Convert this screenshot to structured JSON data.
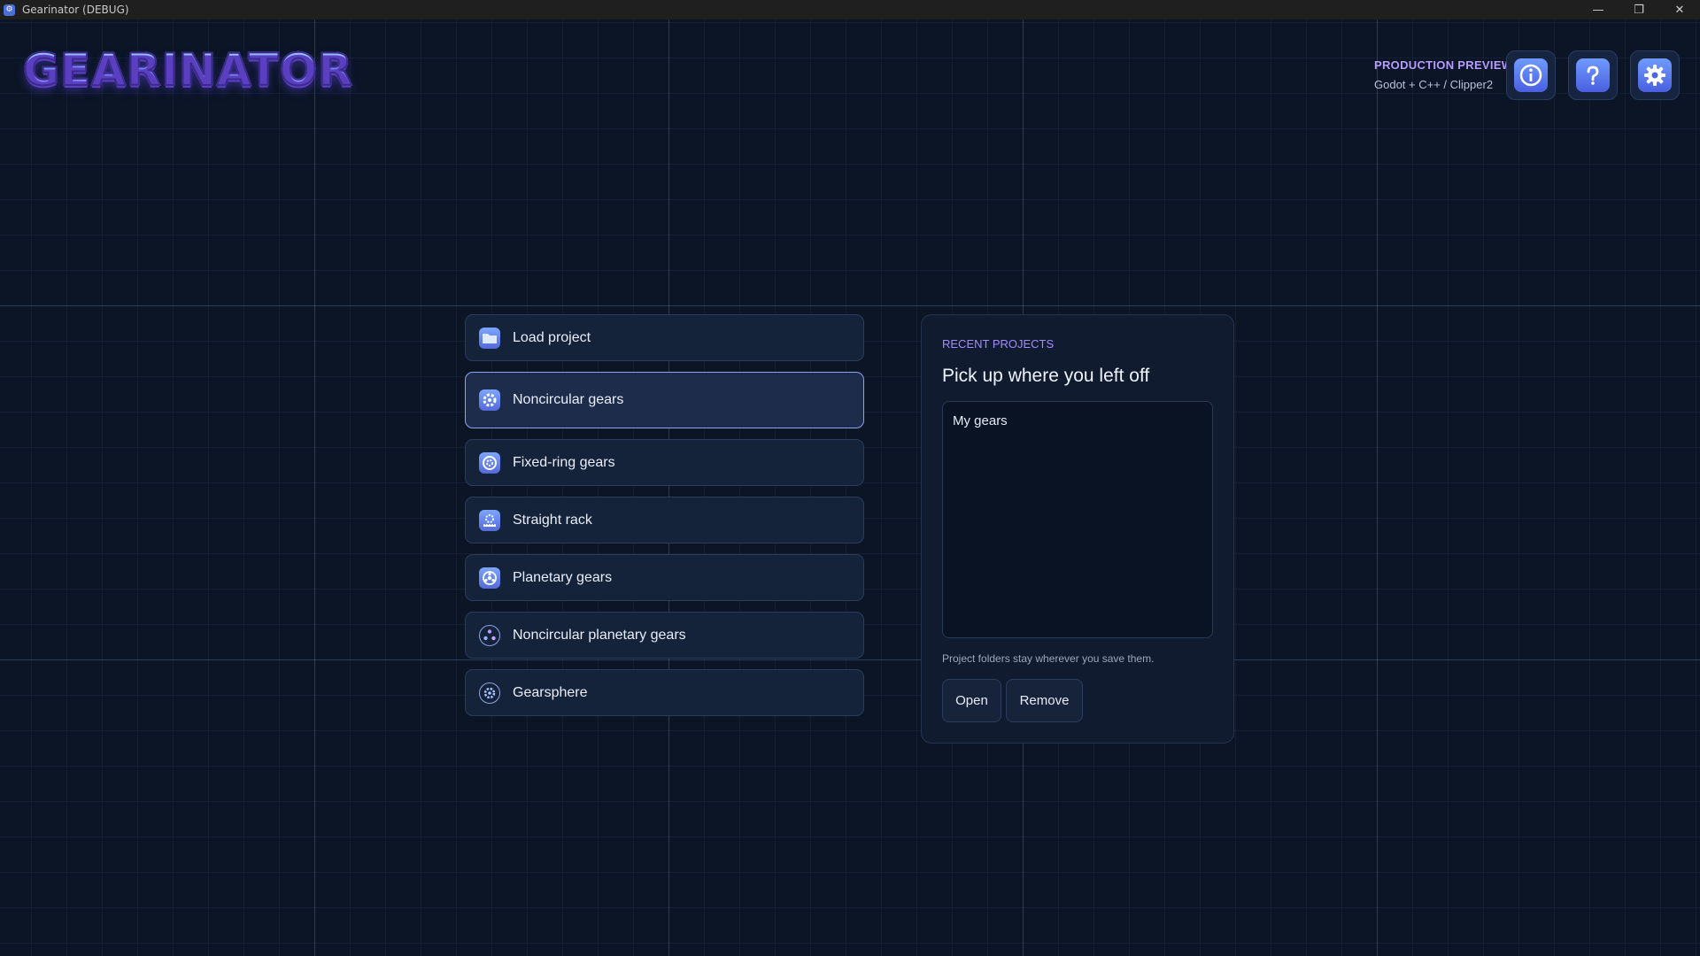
{
  "window": {
    "title": "Gearinator (DEBUG)",
    "controls": [
      "minimize",
      "restore",
      "close"
    ]
  },
  "logo": {
    "text": "GEARINATOR"
  },
  "header": {
    "preview_title": "PRODUCTION PREVIEW",
    "preview_subtitle": "Godot + C++ / Clipper2",
    "buttons": [
      {
        "name": "info",
        "icon": "info-icon"
      },
      {
        "name": "help",
        "icon": "help-icon"
      },
      {
        "name": "settings",
        "icon": "gear-icon"
      }
    ]
  },
  "menu": {
    "items": [
      {
        "label": "Load project",
        "icon": "folder-icon",
        "selected": false
      },
      {
        "label": "Noncircular gears",
        "icon": "gear-icon",
        "selected": true
      },
      {
        "label": "Fixed-ring gears",
        "icon": "ring-gear-icon",
        "selected": false
      },
      {
        "label": "Straight rack",
        "icon": "rack-icon",
        "selected": false
      },
      {
        "label": "Planetary gears",
        "icon": "planetary-icon",
        "selected": false
      },
      {
        "label": "Noncircular planetary gears",
        "icon": "noncircular-planetary-icon",
        "selected": false
      },
      {
        "label": "Gearsphere",
        "icon": "gearsphere-icon",
        "selected": false
      }
    ]
  },
  "recent": {
    "kicker": "RECENT PROJECTS",
    "title": "Pick up where you left off",
    "items": [
      "My gears"
    ],
    "note": "Project folders stay wherever you save them.",
    "open_label": "Open",
    "remove_label": "Remove"
  },
  "colors": {
    "background": "#0b1526",
    "accent": "#a48bff",
    "icon_gradient_top": "#7da6ff",
    "icon_gradient_bottom": "#5369d8"
  }
}
